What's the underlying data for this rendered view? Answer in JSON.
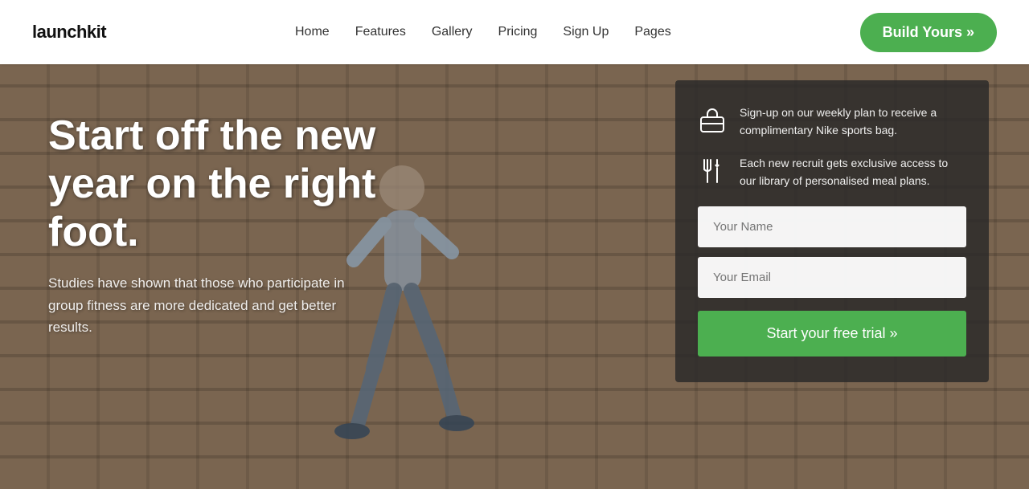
{
  "header": {
    "logo": "launchkit",
    "nav": {
      "items": [
        {
          "label": "Home",
          "id": "home"
        },
        {
          "label": "Features",
          "id": "features"
        },
        {
          "label": "Gallery",
          "id": "gallery"
        },
        {
          "label": "Pricing",
          "id": "pricing"
        },
        {
          "label": "Sign Up",
          "id": "signup"
        },
        {
          "label": "Pages",
          "id": "pages"
        }
      ]
    },
    "cta": "Build Yours »"
  },
  "hero": {
    "title": "Start off the new year on the right foot.",
    "subtitle": "Studies have shown that those who participate in group fitness are more dedicated and get better results.",
    "features": [
      {
        "icon": "bag-icon",
        "text": "Sign-up on our weekly plan to receive a complimentary Nike sports bag."
      },
      {
        "icon": "fork-icon",
        "text": "Each new recruit gets exclusive access to our library of personalised meal plans."
      }
    ],
    "form": {
      "name_placeholder": "Your Name",
      "email_placeholder": "Your Email",
      "submit_label": "Start your free trial »"
    }
  }
}
